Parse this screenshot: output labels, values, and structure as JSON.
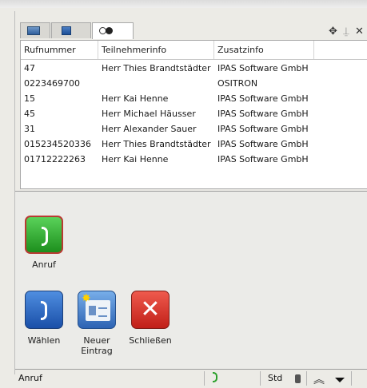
{
  "tabs": [
    {
      "icon": "monitor-icon"
    },
    {
      "icon": "phone-book-icon"
    },
    {
      "icon": "toggle-icon"
    }
  ],
  "window_controls": [
    "move-icon",
    "pin-icon",
    "close-icon"
  ],
  "table": {
    "columns": [
      "Rufnummer",
      "Teilnehmerinfo",
      "Zusatzinfo"
    ],
    "rows": [
      [
        "47",
        "Herr Thies Brandtstädter",
        "IPAS Software GmbH"
      ],
      [
        "0223469700",
        "",
        "OSITRON"
      ],
      [
        "15",
        "Herr Kai Henne",
        "IPAS Software GmbH"
      ],
      [
        "45",
        "Herr Michael Häusser",
        "IPAS Software GmbH"
      ],
      [
        "31",
        "Herr Alexander Sauer",
        "IPAS Software GmbH"
      ],
      [
        "015234520336",
        "Herr Thies Brandtstädter",
        "IPAS Software GmbH"
      ],
      [
        "01712222263",
        "Herr Kai Henne",
        "IPAS Software GmbH"
      ]
    ]
  },
  "actions": {
    "call": {
      "label": "Anruf",
      "icon": "phone-icon"
    },
    "dial": {
      "label": "Wählen",
      "icon": "phone-icon"
    },
    "new_entry": {
      "label_line1": "Neuer",
      "label_line2": "Eintrag",
      "icon": "contact-card-icon"
    },
    "close": {
      "label": "Schließen",
      "icon": "close-x-icon"
    }
  },
  "status": {
    "text": "Anruf",
    "mode": "Std",
    "icons": [
      "call-active-icon",
      "lock-icon",
      "chevron-up-double-icon",
      "dropdown-arrow-icon"
    ]
  },
  "colors": {
    "call_button": "#2fae2f",
    "dial_button": "#2d66c0",
    "close_button": "#d63a2e",
    "accent_green": "#2aa02a"
  }
}
